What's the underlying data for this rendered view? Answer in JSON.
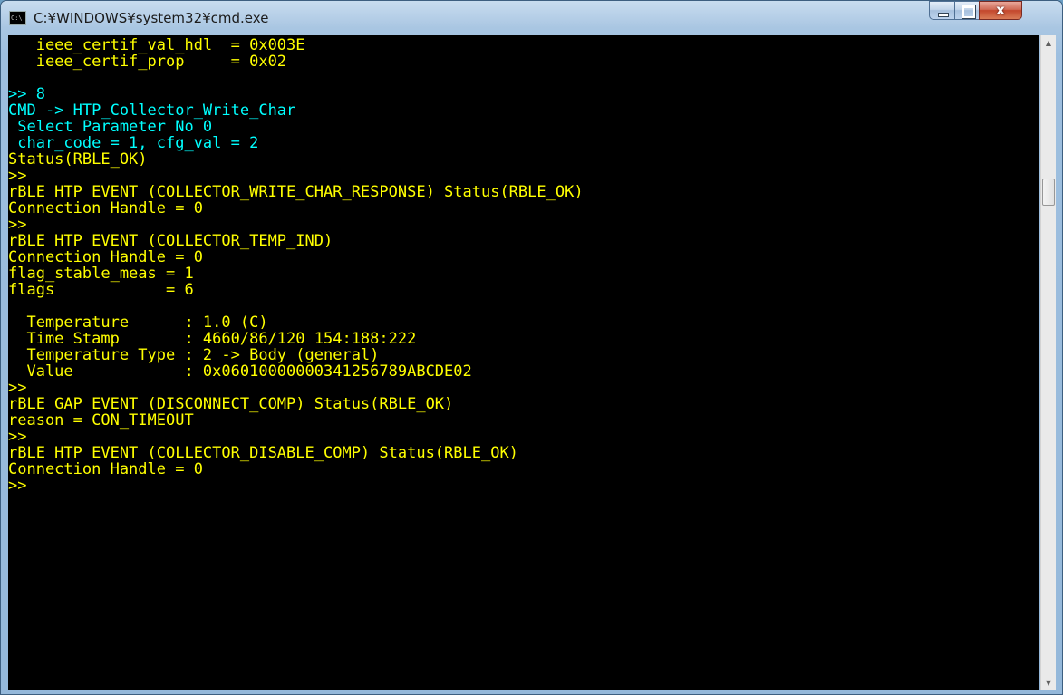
{
  "window": {
    "title": "C:¥WINDOWS¥system32¥cmd.exe",
    "icon": "cmd-icon",
    "icon_text": "C:\\",
    "controls": {
      "minimize": "minimize-icon",
      "maximize": "maximize-icon",
      "close": "close-icon",
      "close_glyph": "x"
    }
  },
  "colors": {
    "yellow": "#ffff00",
    "cyan": "#00ffff",
    "background": "#000000"
  },
  "console": {
    "lines": [
      {
        "text": "   ieee_certif_val_hdl  = 0x003E",
        "color": "yellow"
      },
      {
        "text": "   ieee_certif_prop     = 0x02",
        "color": "yellow"
      },
      {
        "text": "",
        "color": "yellow"
      },
      {
        "text": ">> 8",
        "color": "cyan"
      },
      {
        "text": "CMD -> HTP_Collector_Write_Char",
        "color": "cyan"
      },
      {
        "text": " Select Parameter No 0",
        "color": "cyan"
      },
      {
        "text": " char_code = 1, cfg_val = 2",
        "color": "cyan"
      },
      {
        "text": "Status(RBLE_OK)",
        "color": "yellow"
      },
      {
        "text": ">>",
        "color": "yellow"
      },
      {
        "text": "rBLE HTP EVENT (COLLECTOR_WRITE_CHAR_RESPONSE) Status(RBLE_OK)",
        "color": "yellow"
      },
      {
        "text": "Connection Handle = 0",
        "color": "yellow"
      },
      {
        "text": ">>",
        "color": "yellow"
      },
      {
        "text": "rBLE HTP EVENT (COLLECTOR_TEMP_IND)",
        "color": "yellow"
      },
      {
        "text": "Connection Handle = 0",
        "color": "yellow"
      },
      {
        "text": "flag_stable_meas = 1",
        "color": "yellow"
      },
      {
        "text": "flags            = 6",
        "color": "yellow"
      },
      {
        "text": "",
        "color": "yellow"
      },
      {
        "text": "  Temperature      : 1.0 (C)",
        "color": "yellow"
      },
      {
        "text": "  Time Stamp       : 4660/86/120 154:188:222",
        "color": "yellow"
      },
      {
        "text": "  Temperature Type : 2 -> Body (general)",
        "color": "yellow"
      },
      {
        "text": "  Value            : 0x060100000003412567 89ABCDE02",
        "color": "yellow"
      },
      {
        "text": ">>",
        "color": "yellow"
      },
      {
        "text": "rBLE GAP EVENT (DISCONNECT_COMP) Status(RBLE_OK)",
        "color": "yellow"
      },
      {
        "text": "reason = CON_TIMEOUT",
        "color": "yellow"
      },
      {
        "text": ">>",
        "color": "yellow"
      },
      {
        "text": "rBLE HTP EVENT (COLLECTOR_DISABLE_COMP) Status(RBLE_OK)",
        "color": "yellow"
      },
      {
        "text": "Connection Handle = 0",
        "color": "yellow"
      },
      {
        "text": ">>",
        "color": "yellow"
      }
    ]
  },
  "scrollbar": {
    "up_arrow": "▲",
    "down_arrow": "▼"
  }
}
